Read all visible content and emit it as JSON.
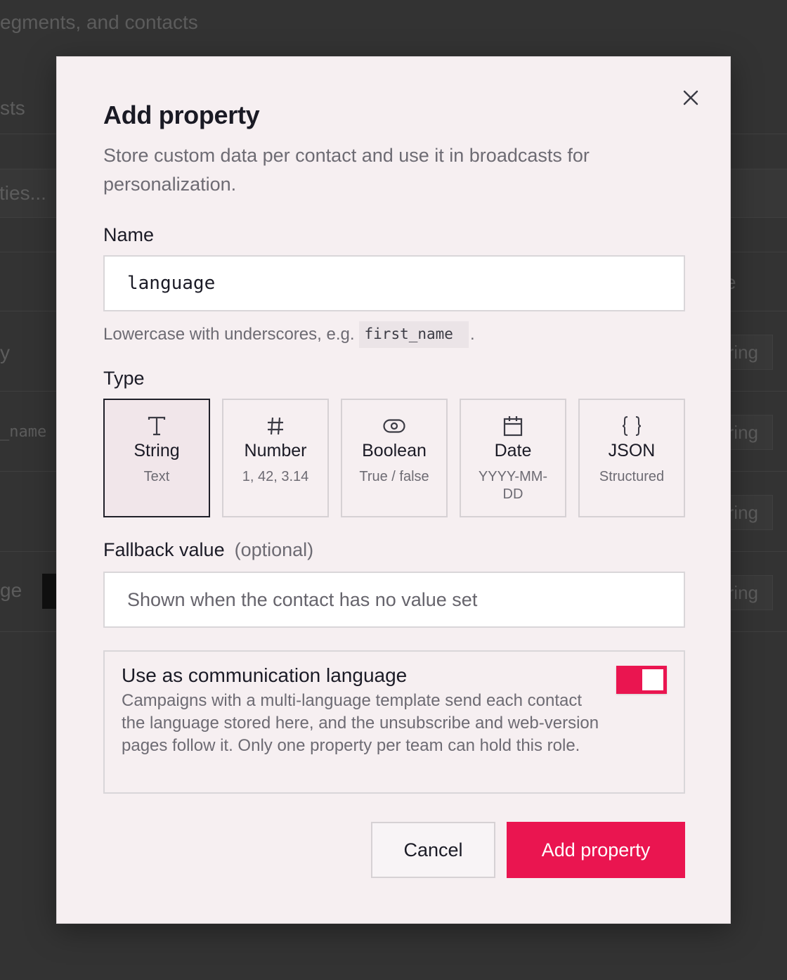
{
  "background": {
    "heading": "egments, and contacts",
    "tab": "sts",
    "search": "ties...",
    "col_fragment": "e",
    "rows": [
      {
        "name": "y",
        "type": "ring"
      },
      {
        "name": "_name",
        "type": "ring"
      },
      {
        "name": "",
        "type": "ring"
      },
      {
        "name": "ge",
        "type": "ring"
      }
    ]
  },
  "modal": {
    "title": "Add property",
    "subtitle": "Store custom data per contact and use it in broadcasts for personalization.",
    "close_icon": "close-icon",
    "name_field": {
      "label": "Name",
      "value": "language",
      "hint_prefix": "Lowercase with underscores, e.g.",
      "hint_example": "first_name",
      "hint_suffix": "."
    },
    "type_field": {
      "label": "Type",
      "selected": "String",
      "options": [
        {
          "icon": "text-t-icon",
          "name": "String",
          "desc": "Text"
        },
        {
          "icon": "hash-icon",
          "name": "Number",
          "desc": "1, 42, 3.14"
        },
        {
          "icon": "toggle-icon",
          "name": "Boolean",
          "desc": "True / false"
        },
        {
          "icon": "calendar-icon",
          "name": "Date",
          "desc": "YYYY-MM-DD"
        },
        {
          "icon": "braces-icon",
          "name": "JSON",
          "desc": "Structured"
        }
      ]
    },
    "fallback_field": {
      "label": "Fallback value",
      "optional": "(optional)",
      "placeholder": "Shown when the contact has no value set"
    },
    "language_option": {
      "title": "Use as communication language",
      "description": "Campaigns with a multi-language template send each contact the language stored here, and the unsubscribe and web-version pages follow it. Only one property per team can hold this role.",
      "enabled": true
    },
    "buttons": {
      "cancel": "Cancel",
      "submit": "Add property"
    }
  },
  "colors": {
    "accent": "#ea1550",
    "modal_bg": "#f6eff1",
    "backdrop": "#3b3b3b"
  }
}
